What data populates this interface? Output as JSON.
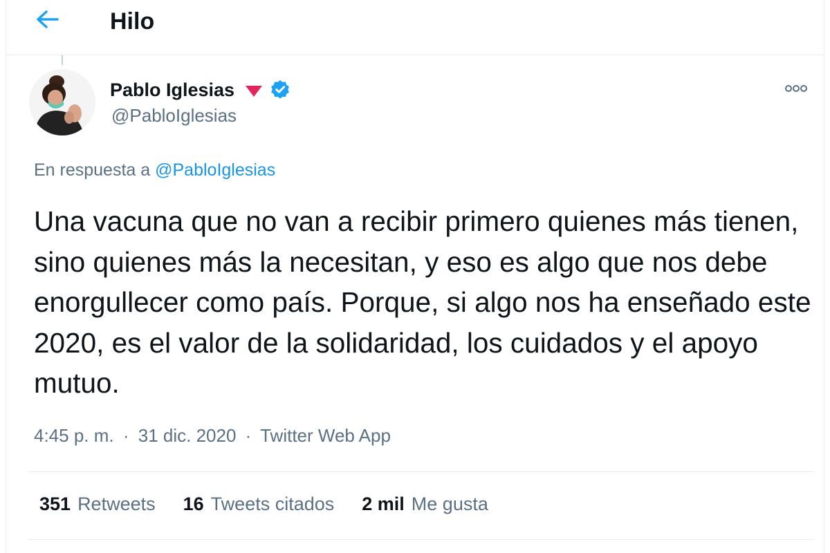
{
  "header": {
    "title": "Hilo",
    "back_icon": "arrow-left-icon"
  },
  "tweet": {
    "author": {
      "name": "Pablo Iglesias",
      "handle": "@PabloIglesias",
      "badge_icon": "rose-icon",
      "verified_icon": "verified-badge-icon"
    },
    "reply_to_prefix": "En respuesta a",
    "reply_to_handle": "@PabloIglesias",
    "text": "Una vacuna que no van a recibir primero quienes más tienen, sino quienes más la necesitan, y eso es algo que nos debe enorgullecer como país. Porque, si algo nos ha enseñado este 2020, es el valor de la solidaridad, los cuidados y el apoyo mutuo.",
    "time": "4:45 p. m.",
    "separator": "·",
    "date": "31 dic. 2020",
    "source": "Twitter Web App",
    "stats": [
      {
        "count": "351",
        "label": "Retweets"
      },
      {
        "count": "16",
        "label": "Tweets citados"
      },
      {
        "count": "2 mil",
        "label": "Me gusta"
      }
    ]
  },
  "colors": {
    "accent": "#1da1f2",
    "link": "#1b95e0",
    "secondary_text": "#5b7083",
    "rose": "#e0245e",
    "border": "#e6ecf0"
  }
}
